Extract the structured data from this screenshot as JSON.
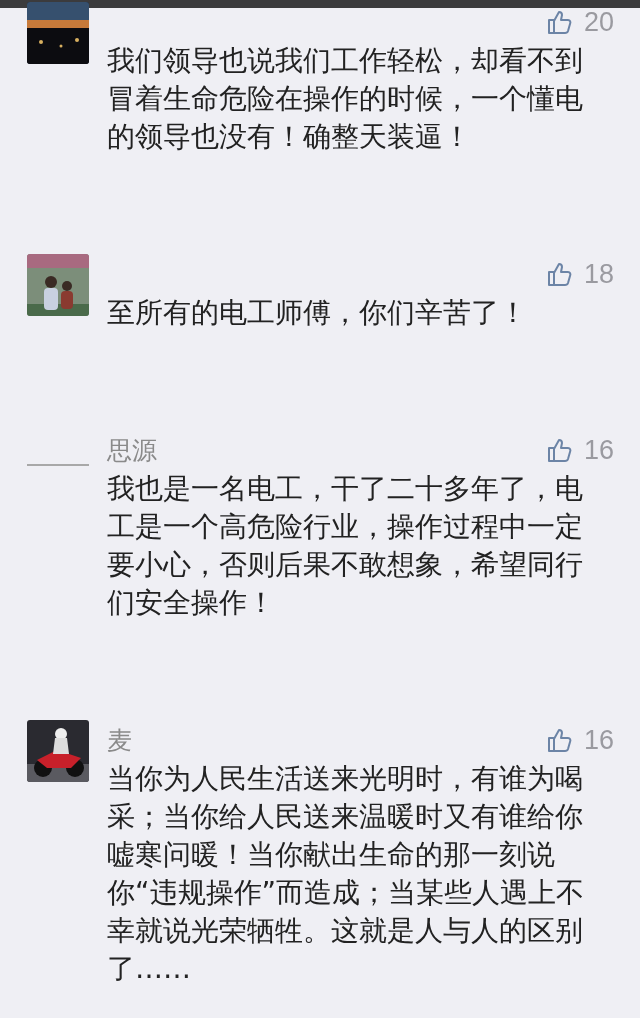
{
  "comments": [
    {
      "likes": "20",
      "text": "我们领导也说我们工作轻松，却看不到冒着生命危险在操作的时候，一个懂电的领导也没有！确整天装逼！"
    },
    {
      "likes": "18",
      "text": "至所有的电工师傅，你们辛苦了！"
    },
    {
      "name": "思源",
      "likes": "16",
      "text": "我也是一名电工，干了二十多年了，电工是一个高危险行业，操作过程中一定要小心，否则后果不敢想象，希望同行们安全操作！"
    },
    {
      "name": "麦",
      "likes": "16",
      "text": "当你为人民生活送来光明时，有谁为喝采；当你给人民送来温暖时又有谁给你嘘寒问暖！当你献出生命的那一刻说你“违规操作”而造成；当某些人遇上不幸就说光荣牺牲。这就是人与人的区别了……"
    }
  ]
}
